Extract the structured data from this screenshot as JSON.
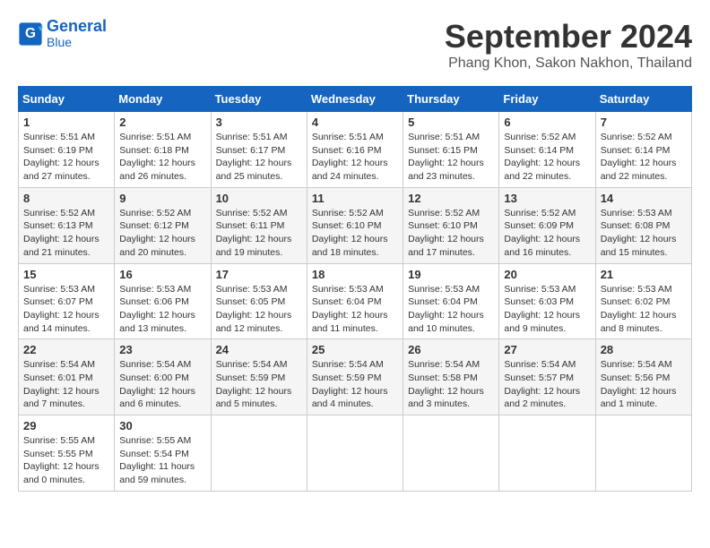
{
  "header": {
    "logo_line1": "General",
    "logo_line2": "Blue",
    "month_title": "September 2024",
    "location": "Phang Khon, Sakon Nakhon, Thailand"
  },
  "days_of_week": [
    "Sunday",
    "Monday",
    "Tuesday",
    "Wednesday",
    "Thursday",
    "Friday",
    "Saturday"
  ],
  "weeks": [
    [
      {
        "day": "1",
        "sunrise": "5:51 AM",
        "sunset": "6:19 PM",
        "daylight": "12 hours and 27 minutes."
      },
      {
        "day": "2",
        "sunrise": "5:51 AM",
        "sunset": "6:18 PM",
        "daylight": "12 hours and 26 minutes."
      },
      {
        "day": "3",
        "sunrise": "5:51 AM",
        "sunset": "6:17 PM",
        "daylight": "12 hours and 25 minutes."
      },
      {
        "day": "4",
        "sunrise": "5:51 AM",
        "sunset": "6:16 PM",
        "daylight": "12 hours and 24 minutes."
      },
      {
        "day": "5",
        "sunrise": "5:51 AM",
        "sunset": "6:15 PM",
        "daylight": "12 hours and 23 minutes."
      },
      {
        "day": "6",
        "sunrise": "5:52 AM",
        "sunset": "6:14 PM",
        "daylight": "12 hours and 22 minutes."
      },
      {
        "day": "7",
        "sunrise": "5:52 AM",
        "sunset": "6:14 PM",
        "daylight": "12 hours and 22 minutes."
      }
    ],
    [
      {
        "day": "8",
        "sunrise": "5:52 AM",
        "sunset": "6:13 PM",
        "daylight": "12 hours and 21 minutes."
      },
      {
        "day": "9",
        "sunrise": "5:52 AM",
        "sunset": "6:12 PM",
        "daylight": "12 hours and 20 minutes."
      },
      {
        "day": "10",
        "sunrise": "5:52 AM",
        "sunset": "6:11 PM",
        "daylight": "12 hours and 19 minutes."
      },
      {
        "day": "11",
        "sunrise": "5:52 AM",
        "sunset": "6:10 PM",
        "daylight": "12 hours and 18 minutes."
      },
      {
        "day": "12",
        "sunrise": "5:52 AM",
        "sunset": "6:10 PM",
        "daylight": "12 hours and 17 minutes."
      },
      {
        "day": "13",
        "sunrise": "5:52 AM",
        "sunset": "6:09 PM",
        "daylight": "12 hours and 16 minutes."
      },
      {
        "day": "14",
        "sunrise": "5:53 AM",
        "sunset": "6:08 PM",
        "daylight": "12 hours and 15 minutes."
      }
    ],
    [
      {
        "day": "15",
        "sunrise": "5:53 AM",
        "sunset": "6:07 PM",
        "daylight": "12 hours and 14 minutes."
      },
      {
        "day": "16",
        "sunrise": "5:53 AM",
        "sunset": "6:06 PM",
        "daylight": "12 hours and 13 minutes."
      },
      {
        "day": "17",
        "sunrise": "5:53 AM",
        "sunset": "6:05 PM",
        "daylight": "12 hours and 12 minutes."
      },
      {
        "day": "18",
        "sunrise": "5:53 AM",
        "sunset": "6:04 PM",
        "daylight": "12 hours and 11 minutes."
      },
      {
        "day": "19",
        "sunrise": "5:53 AM",
        "sunset": "6:04 PM",
        "daylight": "12 hours and 10 minutes."
      },
      {
        "day": "20",
        "sunrise": "5:53 AM",
        "sunset": "6:03 PM",
        "daylight": "12 hours and 9 minutes."
      },
      {
        "day": "21",
        "sunrise": "5:53 AM",
        "sunset": "6:02 PM",
        "daylight": "12 hours and 8 minutes."
      }
    ],
    [
      {
        "day": "22",
        "sunrise": "5:54 AM",
        "sunset": "6:01 PM",
        "daylight": "12 hours and 7 minutes."
      },
      {
        "day": "23",
        "sunrise": "5:54 AM",
        "sunset": "6:00 PM",
        "daylight": "12 hours and 6 minutes."
      },
      {
        "day": "24",
        "sunrise": "5:54 AM",
        "sunset": "5:59 PM",
        "daylight": "12 hours and 5 minutes."
      },
      {
        "day": "25",
        "sunrise": "5:54 AM",
        "sunset": "5:59 PM",
        "daylight": "12 hours and 4 minutes."
      },
      {
        "day": "26",
        "sunrise": "5:54 AM",
        "sunset": "5:58 PM",
        "daylight": "12 hours and 3 minutes."
      },
      {
        "day": "27",
        "sunrise": "5:54 AM",
        "sunset": "5:57 PM",
        "daylight": "12 hours and 2 minutes."
      },
      {
        "day": "28",
        "sunrise": "5:54 AM",
        "sunset": "5:56 PM",
        "daylight": "12 hours and 1 minute."
      }
    ],
    [
      {
        "day": "29",
        "sunrise": "5:55 AM",
        "sunset": "5:55 PM",
        "daylight": "12 hours and 0 minutes."
      },
      {
        "day": "30",
        "sunrise": "5:55 AM",
        "sunset": "5:54 PM",
        "daylight": "11 hours and 59 minutes."
      },
      null,
      null,
      null,
      null,
      null
    ]
  ]
}
